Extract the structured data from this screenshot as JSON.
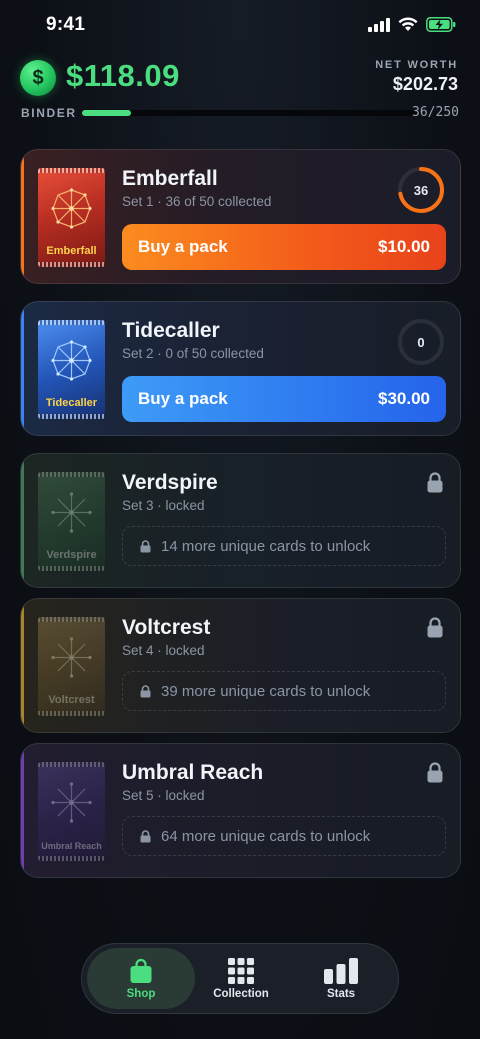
{
  "status_bar": {
    "time": "9:41"
  },
  "header": {
    "coin_symbol": "$",
    "balance": "$118.09",
    "net_worth_label": "NET WORTH",
    "net_worth_value": "$202.73"
  },
  "binder": {
    "label": "BINDER",
    "count": "36/250",
    "progress": 0.144
  },
  "sets": [
    {
      "name": "Emberfall",
      "subtitle": "Set 1 · 36 of 50 collected",
      "pack_label": "Emberfall",
      "progress_count": "36",
      "progress": 0.72,
      "buy_label": "Buy a pack",
      "price": "$10.00",
      "accent": "#f97316"
    },
    {
      "name": "Tidecaller",
      "subtitle": "Set 2 · 0 of 50 collected",
      "pack_label": "Tidecaller",
      "progress_count": "0",
      "progress": 0,
      "buy_label": "Buy a pack",
      "price": "$30.00",
      "accent": "#3b82f6"
    },
    {
      "name": "Verdspire",
      "subtitle": "Set 3 · locked",
      "pack_label": "Verdspire",
      "unlock_text": "14 more unique cards to unlock",
      "accent": "#3f7a52"
    },
    {
      "name": "Voltcrest",
      "subtitle": "Set 4 · locked",
      "pack_label": "Voltcrest",
      "unlock_text": "39 more unique cards to unlock",
      "accent": "#a78428"
    },
    {
      "name": "Umbral Reach",
      "subtitle": "Set 5 · locked",
      "pack_label": "Umbral Reach",
      "unlock_text": "64 more unique cards to unlock",
      "accent": "#6d3fb0"
    }
  ],
  "tabs": [
    {
      "label": "Shop",
      "icon": "bag-icon",
      "active": true
    },
    {
      "label": "Collection",
      "icon": "grid-icon",
      "active": false
    },
    {
      "label": "Stats",
      "icon": "bar-chart-icon",
      "active": false
    }
  ]
}
